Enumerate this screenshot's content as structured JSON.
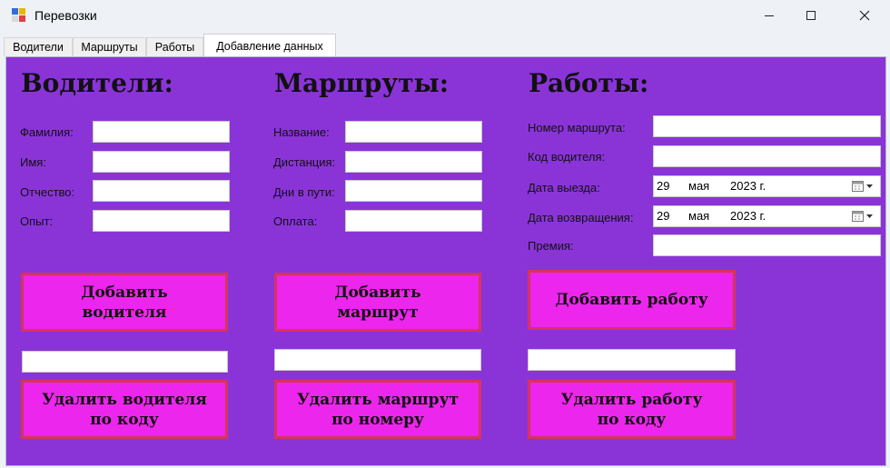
{
  "window": {
    "title": "Перевозки"
  },
  "tabs": [
    {
      "label": "Водители"
    },
    {
      "label": "Маршруты"
    },
    {
      "label": "Работы"
    },
    {
      "label": "Добавление данных",
      "active": true
    }
  ],
  "drivers": {
    "title": "Водители:",
    "fields": {
      "last_name": {
        "label": "Фамилия:",
        "value": ""
      },
      "first_name": {
        "label": "Имя:",
        "value": ""
      },
      "patronymic": {
        "label": "Отчество:",
        "value": ""
      },
      "experience": {
        "label": "Опыт:",
        "value": ""
      }
    },
    "add_button": "Добавить\nводителя",
    "delete_input": "",
    "delete_button": "Удалить водителя\nпо коду"
  },
  "routes": {
    "title": "Маршруты:",
    "fields": {
      "name": {
        "label": "Название:",
        "value": ""
      },
      "distance": {
        "label": "Дистанция:",
        "value": ""
      },
      "days": {
        "label": "Дни в пути:",
        "value": ""
      },
      "payment": {
        "label": "Оплата:",
        "value": ""
      }
    },
    "add_button": "Добавить\nмаршрут",
    "delete_input": "",
    "delete_button": "Удалить маршрут\nпо номеру"
  },
  "jobs": {
    "title": "Работы:",
    "fields": {
      "route_number": {
        "label": "Номер маршрута:",
        "value": ""
      },
      "driver_code": {
        "label": "Код водителя:",
        "value": ""
      },
      "departure_date": {
        "label": "Дата выезда:",
        "day": "29",
        "month": "мая",
        "year": "2023 г."
      },
      "return_date": {
        "label": "Дата возвращения:",
        "day": "29",
        "month": "мая",
        "year": "2023 г."
      },
      "bonus": {
        "label": "Премия:",
        "value": ""
      }
    },
    "add_button": "Добавить работу",
    "delete_input": "",
    "delete_button": "Удалить работу\nпо коду"
  },
  "colors": {
    "panel": "#8a34d8",
    "button_fill": "#ec26ec",
    "button_border": "#d7335e"
  }
}
